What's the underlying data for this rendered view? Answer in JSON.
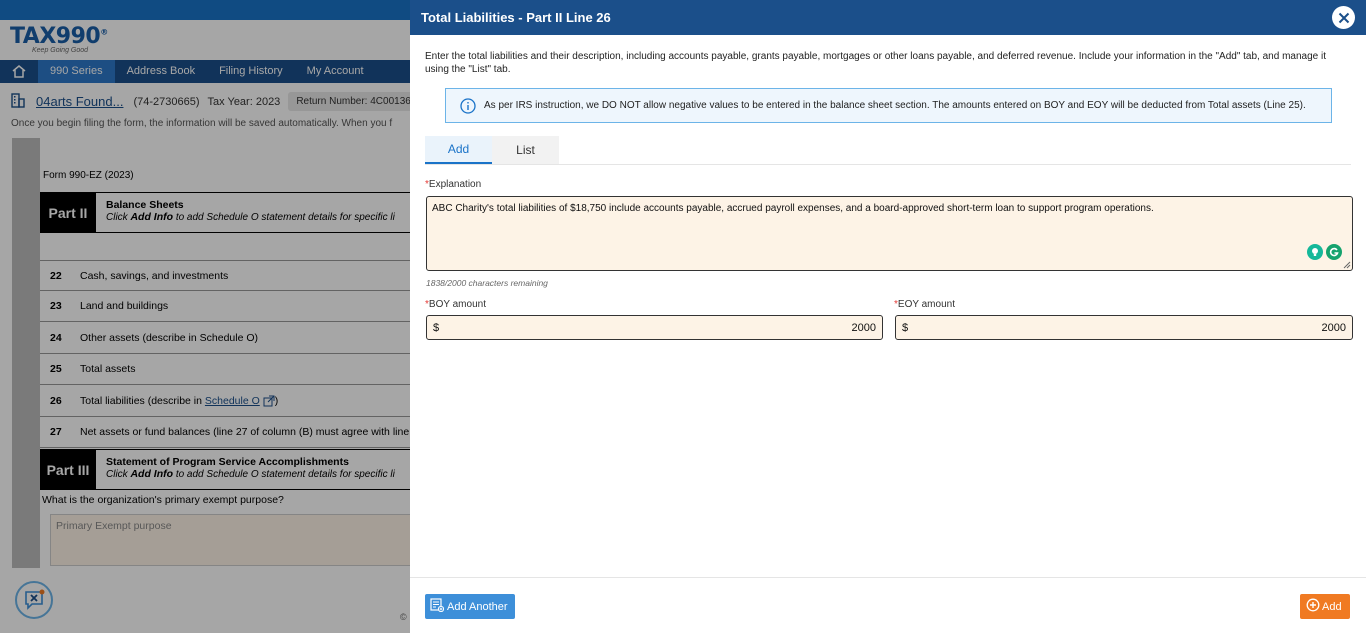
{
  "app": {
    "logo": "TAX990",
    "logo_mark": "®",
    "tagline": "Keep Going Good",
    "nav": [
      "990 Series",
      "Address Book",
      "Filing History",
      "My Account"
    ],
    "org_name": "04arts Found...",
    "ein": "(74-2730665)",
    "tax_year": "Tax Year: 2023",
    "return_number": "Return Number: 4C001362",
    "autosave_note": "Once you begin filing the form, the information will be saved automatically. When you f",
    "form_title": "Form 990-EZ (2023)",
    "part2": {
      "label": "Part II",
      "title": "Balance Sheets",
      "note_pre": "Click",
      "note_bold": "Add Info",
      "note_post": "to add Schedule O statement details for specific li"
    },
    "lines": [
      {
        "num": "22",
        "desc": "Cash, savings, and investments"
      },
      {
        "num": "23",
        "desc": "Land and buildings"
      },
      {
        "num": "24",
        "desc": "Other assets (describe in Schedule O)"
      },
      {
        "num": "25",
        "desc": "Total assets"
      },
      {
        "num": "26",
        "desc": "Total liabilities (describe in",
        "link": "Schedule O",
        "after": ")"
      },
      {
        "num": "27",
        "desc": "Net assets or fund balances (line 27 of column (B) must agree with line"
      }
    ],
    "part3": {
      "label": "Part III",
      "title": "Statement of Program Service Accomplishments",
      "note_pre": "Click",
      "note_bold": "Add Info",
      "note_post": "to add Schedule O statement details for specific li"
    },
    "purpose_question": "What is the organization's primary exempt purpose?",
    "purpose_placeholder": "Primary Exempt purpose",
    "footer_fragment": "©"
  },
  "drawer": {
    "title": "Total Liabilities - Part II Line 26",
    "intro": "Enter the total liabilities and their description, including accounts payable, grants payable, mortgages or other loans payable, and deferred revenue. Include your information in the \"Add\" tab, and manage it using the \"List\" tab.",
    "notice": "As per IRS instruction, we DO NOT allow negative values to be entered in the balance sheet section. The amounts entered on BOY and EOY will be deducted from Total assets (Line 25).",
    "tabs": [
      "Add",
      "List"
    ],
    "active_tab": "Add",
    "explanation_label": "Explanation",
    "explanation_value": "ABC Charity's total liabilities of $18,750 include accounts payable, accrued payroll expenses, and a board-approved short-term loan to support program operations.",
    "remaining": "1838/2000 characters remaining",
    "boy_label": "BOY amount",
    "boy_currency": "$",
    "boy_value": "2000",
    "eoy_label": "EOY amount",
    "eoy_currency": "$",
    "eoy_value": "2000",
    "required_mark": "*",
    "add_another_label": "Add Another",
    "add_label": "Add"
  },
  "colors": {
    "header_blue": "#1b4f8a",
    "accent_blue": "#1a73c8",
    "add_orange": "#f07a22",
    "input_bg": "#fdf3e6",
    "required_red": "#e53935"
  }
}
